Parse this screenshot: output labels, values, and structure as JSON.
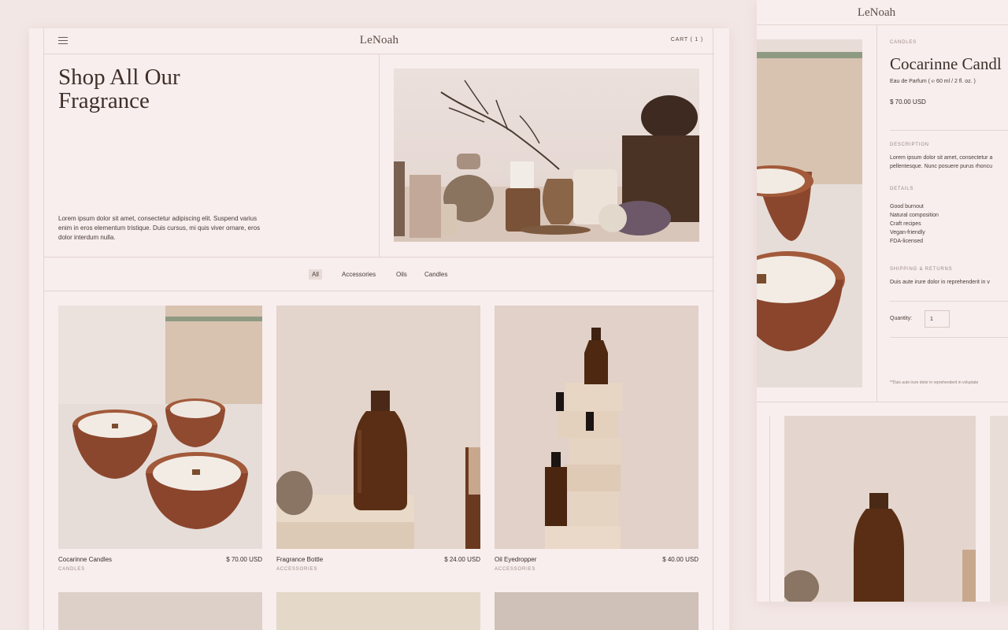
{
  "shop": {
    "logo": "LeNoah",
    "cart_label": "CART ( 1 )",
    "hero": {
      "title": "Shop All Our Fragrance",
      "description": "Lorem ipsum dolor sit amet, consectetur adipiscing elit. Suspend varius enim in eros elementum tristique. Duis cursus, mi quis viver ornare, eros dolor interdum nulla."
    },
    "filters": [
      "All",
      "Accessories",
      "Oils",
      "Candles"
    ],
    "active_filter": "All",
    "products": [
      {
        "name": "Cocarinne Candles",
        "price": "$ 70.00 USD",
        "category": "CANDLES",
        "image": "candle-bowls"
      },
      {
        "name": "Fragrance Bottle",
        "price": "$ 24.00 USD",
        "category": "ACCESSORIES",
        "image": "amber-bottle"
      },
      {
        "name": "Oil Eyedropper",
        "price": "$ 40.00 USD",
        "category": "ACCESSORIES",
        "image": "eyedropper-bottles"
      }
    ]
  },
  "product_page": {
    "logo": "LeNoah",
    "category": "CANDLES",
    "title": "Cocarinne Candl",
    "subtitle": "Eau de Parfum ( ℮ 60 ml / 2 fl. oz. )",
    "price": "$ 70.00 USD",
    "description_label": "DESCRIPTION",
    "description_line1": "Lorem ipsum dolor sit amet, consectetur a",
    "description_line2": "pellentesque. Nunc posuere purus rhoncu",
    "details_label": "DETAILS",
    "details": [
      "Good burnout",
      "Natural composition",
      "Craft recipes",
      "Vegan-friendly",
      "FDA-licensed"
    ],
    "shipping_label": "SHIPPING & RETURNS",
    "shipping_text": "Duis aute irure dolor in reprehenderit in v",
    "quantity_label": "Quantity:",
    "quantity_value": "1",
    "note": "**Duis aute irure dolor in reprehenderit in voluptate"
  },
  "colors": {
    "background": "#f3e7e5",
    "panel": "#f8eeed",
    "rule": "#e3d4d1",
    "text": "#3a2e2a",
    "muted": "#9a8985",
    "amber": "#5a2e14"
  }
}
